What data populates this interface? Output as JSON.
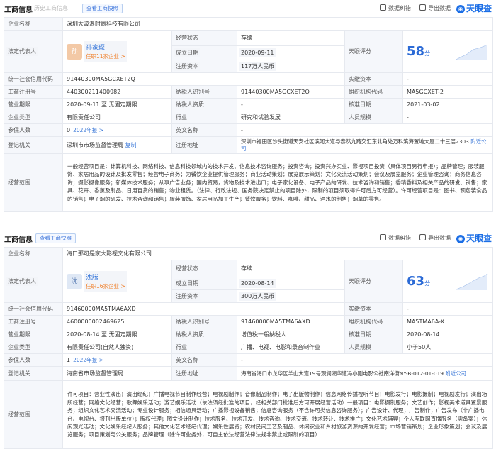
{
  "panel_a": {
    "toolbar": {
      "title": "工商信息",
      "history": "历史工商信息",
      "report_btn": "查看工商快照",
      "export_data": "数据纠错",
      "export": "导出数据",
      "brand": "天眼查"
    },
    "rows": {
      "company_name_label": "企业名称",
      "company_name": "深圳大波浪时尚科技有限公司",
      "legal_rep_label": "法定代表人",
      "legal_rep_avatar": "孙",
      "legal_rep_name": "孙家琛",
      "legal_rep_tag": "任职11家企业 >",
      "status_label": "经营状态",
      "status": "存续",
      "established_label": "成立日期",
      "established": "2020-09-11",
      "capital_label": "注册资本",
      "capital": "117万人民币",
      "score_label": "天眼评分",
      "score": "58",
      "score_unit": "分",
      "credit_code_label": "统一社会信用代码",
      "credit_code": "91440300MA5GCXET2Q",
      "paidin_label": "实缴资本",
      "paidin": "-",
      "reg_no_label": "工商注册号",
      "reg_no": "440300211400982",
      "taxpayer_label": "纳税人识别号",
      "taxpayer": "91440300MA5GCXET2Q",
      "org_code_label": "组织机构代码",
      "org_code": "MA5GCXET-2",
      "term_label": "营业期限",
      "term": "2020-09-11 至 无固定期限",
      "tax_qual_label": "纳税人资质",
      "tax_qual": "-",
      "approve_label": "核准日期",
      "approve": "2021-03-02",
      "type_label": "企业类型",
      "type": "有限责任公司",
      "industry_label": "行业",
      "industry": "研究和试验发展",
      "staff_label": "人员规模",
      "staff": "-",
      "insured_label": "参保人数",
      "insured": "0",
      "insured_year": "2022年报 >",
      "en_name_label": "英文名称",
      "en_name": "-",
      "authority_label": "登记机关",
      "authority": "深圳市市场监督管理局",
      "copy": "复制",
      "address_label": "注册地址",
      "address": "深圳市福田区沙头街道天安社区滨河大道与泰然九路交汇东北角处万科滨海置地大厦二十三层2303",
      "nearby": "附近公司",
      "scope_label": "经营范围",
      "scope": "一般经营项目是：计算机科技、网络科技、信息科技领域内的技术开发、信息技术咨询服务；投资咨询；投资兴办实业、影视项目投资（具体项目另行申报）；品牌管理；服装服饰、家居用品的设计及批发零售；经营电子商务；为餐饮企业提供管理服务；商业活动策划；展览展示策划；文化交流活动策划；会议及展览服务；企业管理咨询；商务信息咨询；摄影摄像服务；新媒体技术服务；从事广告业务；国内贸易，货物及技术进出口；电子家化设备、电子产品的研发、技术咨询和销售；香精香料及相关产品的研发、销售；家具、花卉、香薰及制品、日用百货的销售；物业租赁。（法律、行政法规、国务院决定禁止的项目除外，限制的项目须取得许可后方可经营）。许可经营项目是：图书、预包装食品的销售；电子烟的研发、技术咨询和销售；服装服饰、家居用品加工生产；餐饮服务；饮料、咖啡、甜品、酒水的制售；烟草的零售。"
    }
  },
  "panel_b": {
    "toolbar": {
      "title": "工商信息",
      "report_btn": "查看工商快照",
      "export_data": "数据纠错",
      "export": "导出数据",
      "brand": "天眼查"
    },
    "rows": {
      "company_name_label": "企业名称",
      "company_name": "海口那可是家大影视文化有限公司",
      "legal_rep_label": "法定代表人",
      "legal_rep_avatar": "沈",
      "legal_rep_name": "沈腾",
      "legal_rep_tag": "任职16家企业 >",
      "status_label": "经营状态",
      "status": "存续",
      "established_label": "成立日期",
      "established": "2020-08-14",
      "capital_label": "注册资本",
      "capital": "300万人民币",
      "score_label": "天眼评分",
      "score": "63",
      "score_unit": "分",
      "credit_code_label": "统一社会信用代码",
      "credit_code": "91460000MA5TMA6AXD",
      "paidin_label": "实缴资本",
      "paidin": "-",
      "reg_no_label": "工商注册号",
      "reg_no": "460000000246962​5",
      "taxpayer_label": "纳税人识别号",
      "taxpayer": "91460000MA5TMA6AXD",
      "org_code_label": "组织机构代码",
      "org_code": "MA5TMA6A-X",
      "term_label": "营业期限",
      "term": "2020-08-14 至 无固定期限",
      "tax_qual_label": "纳税人资质",
      "tax_qual": "增值税一般纳税人",
      "approve_label": "核准日期",
      "approve": "2020-08-14",
      "type_label": "企业类型",
      "type": "有限责任公司(自然人独资)",
      "industry_label": "行业",
      "industry": "广播、电视、电影和录音制作业",
      "staff_label": "人员规模",
      "staff": "小于50人",
      "insured_label": "参保人数",
      "insured": "1",
      "insured_year": "2022年报 >",
      "en_name_label": "英文名称",
      "en_name": "-",
      "authority_label": "登记机关",
      "authority": "海南省市场监督管理局",
      "address_label": "注册地址",
      "address": "海南省海口市龙华区羊山大道19号观澜湖华谊冯小刚电影公社南洋街NY-B-012-01-019",
      "nearby": "附近公司",
      "scope_label": "经营范围",
      "scope": "许可项目：营业性演出；演出经纪；广播电视节目制作经营；电视剧制作；音像制品制作；电子出版物制作；信息网络传播视听节目；电影发行；电影摄制；电视剧发行；演出场所经营；网络文化经营；歌舞娱乐活动；游艺娱乐活动（依法须经批准的项目，经相关部门批准后方可开展经营活动）一般项目：电影摄制服务；文艺创作；影视美术道具置景服务；组织文化艺术交流活动；专业设计服务；相信通具活动；广播影视设备销售；信息咨询服务（不含许可类信息咨询服务）；广告设计、代理；广告制作；广告发布（非广播电台、电视台、报刊出版单位）；版权代理；图文设计制作；技术服务、技术开发、技术咨询、技术交流、技术转让、技术推广；文化艺术辅导；个人互联网直播服务（需备案）；休闲观光活动；文化娱乐经纪人服务；其他文化艺术经纪代理；娱乐性展览；农村民间工艺及制品、休闲农业和乡村旅游资源的开发经营；市场营销策划；企业形象策划；会议及展览服务；项目策划与公关服务；品牌管理（除许可业务外，可自主依法经营法律法规非禁止或限制的项目）"
    }
  }
}
